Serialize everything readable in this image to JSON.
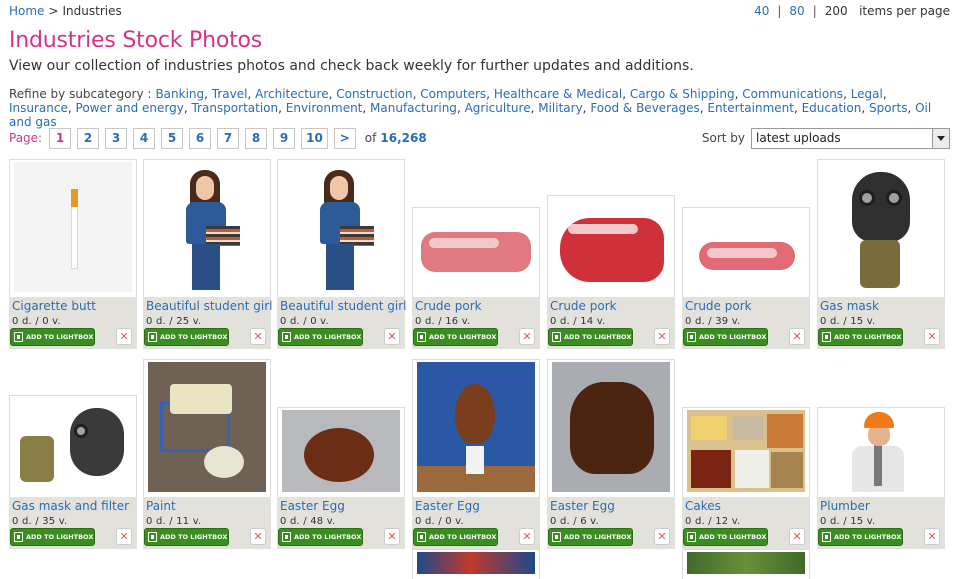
{
  "breadcrumb": {
    "home": "Home",
    "separator": ">",
    "current": "Industries"
  },
  "per_page": {
    "options": [
      "40",
      "80",
      "200"
    ],
    "current": "200",
    "label": "items per page"
  },
  "heading": "Industries Stock Photos",
  "intro": "View our collection of industries photos and check back weekly for further updates and additions.",
  "refine": {
    "label": "Refine by subcategory :",
    "items": [
      "Banking",
      "Travel",
      "Architecture",
      "Construction",
      "Computers",
      "Healthcare & Medical",
      "Cargo & Shipping",
      "Communications",
      "Legal",
      "Insurance",
      "Power and energy",
      "Transportation",
      "Environment",
      "Manufacturing",
      "Agriculture",
      "Military",
      "Food & Beverages",
      "Entertainment",
      "Education",
      "Sports",
      "Oil and gas"
    ]
  },
  "pager": {
    "label": "Page:",
    "pages": [
      "1",
      "2",
      "3",
      "4",
      "5",
      "6",
      "7",
      "8",
      "9",
      "10"
    ],
    "current": "1",
    "next": ">",
    "of_label": "of",
    "total": "16,268"
  },
  "sort": {
    "label": "Sort by",
    "value": "latest uploads"
  },
  "lightbox_label": "ADD TO LIGHTBOX",
  "remove_glyph": "✕",
  "photos": [
    {
      "title": "Cigarette butt",
      "stats": "0 d. / 0 v."
    },
    {
      "title": "Beautiful student girl",
      "stats": "0 d. / 25 v."
    },
    {
      "title": "Beautiful student girl",
      "stats": "0 d. / 0 v."
    },
    {
      "title": "Crude pork",
      "stats": "0 d. / 16 v."
    },
    {
      "title": "Crude pork",
      "stats": "0 d. / 14 v."
    },
    {
      "title": "Crude pork",
      "stats": "0 d. / 39 v."
    },
    {
      "title": "Gas mask",
      "stats": "0 d. / 15 v."
    },
    {
      "title": "Gas mask and filter",
      "stats": "0 d. / 35 v."
    },
    {
      "title": "Paint",
      "stats": "0 d. / 11 v."
    },
    {
      "title": "Easter Egg",
      "stats": "0 d. / 48 v."
    },
    {
      "title": "Easter Egg",
      "stats": "0 d. / 0 v."
    },
    {
      "title": "Easter Egg",
      "stats": "0 d. / 6 v."
    },
    {
      "title": "Cakes",
      "stats": "0 d. / 12 v."
    },
    {
      "title": "Plumber",
      "stats": "0 d. / 15 v."
    }
  ]
}
